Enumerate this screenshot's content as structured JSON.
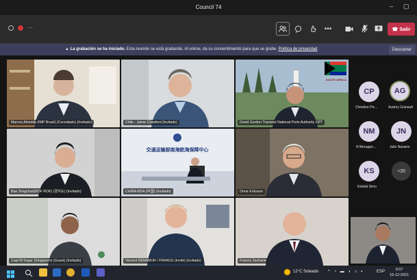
{
  "window": {
    "title": "Council 74",
    "minimize": "–",
    "restore": "▢"
  },
  "toolbar": {
    "leave_label": "Salir"
  },
  "banner": {
    "lead": "La grabación se ha iniciado.",
    "body": "Esta reunión se está grabando. Al unirse, da su consentimiento para que se grabe.",
    "link": "Política de privacidad",
    "dismiss": "Descartar"
  },
  "participants": [
    {
      "name": "Marcos Almeida (IMP Brazil) (Convidado) (Invitado)",
      "colors": [
        "#9a7a56",
        "#e8e2d6"
      ]
    },
    {
      "name": "Chile - Jaime Crawford (Invitado)",
      "colors": [
        "#cfd3d6",
        "#e6e8ea"
      ]
    },
    {
      "name": "David Gordon Transnet National Ports Authority CPT",
      "colors": [
        "#5b7a55",
        "#a9b7c5"
      ]
    },
    {
      "name": "Bae Yongchan(KOF ROK) (경지도) (Invitado)",
      "colors": [
        "#c8c8c8",
        "#e2e2e2"
      ]
    },
    {
      "name": "CHINA MSA (中国) (Invitado)",
      "colors": [
        "#e9ecf1",
        "#dfe3ea"
      ]
    },
    {
      "name": "Omar Eriksson",
      "colors": [
        "#6e6457",
        "#9b8e7c"
      ]
    },
    {
      "name": "Capt M Segar (Singapore) (Guest) (Invitado)",
      "colors": [
        "#d9d9d9",
        "#b9c3b5"
      ]
    },
    {
      "name": "Vincent DENAMUR / FRANCE (Invité) (Invitado)",
      "colors": [
        "#d6d4d0",
        "#ebe9e6"
      ]
    },
    {
      "name": "Francis Zacharie",
      "colors": [
        "#d9d7d3",
        "#cfc8bd"
      ]
    }
  ],
  "china_logo_text": "交通运输部南海航海保障中心",
  "south_africa_label": "SOUTH AFRICA",
  "roster": [
    {
      "initials": "CP",
      "name": "Christine Pic..."
    },
    {
      "initials": "AG",
      "name": "Audrey Guinault"
    },
    {
      "initials": "NM",
      "name": "N Murugan..."
    },
    {
      "initials": "JN",
      "name": "Julie Navarre"
    },
    {
      "initials": "KS",
      "name": "Keitelá Sirvo"
    }
  ],
  "roster_more": "+35",
  "taskbar": {
    "weather": "12°C Soleado",
    "lang": "ESP",
    "time": "9:07",
    "date": "15-12-2021"
  }
}
